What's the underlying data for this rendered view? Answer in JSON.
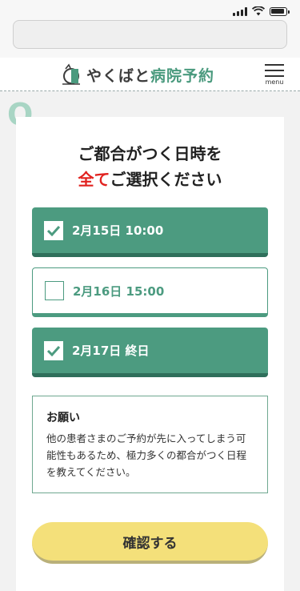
{
  "header": {
    "logo_part1": "やくばと",
    "logo_part2": "病院予約",
    "menu_label": "menu"
  },
  "question": {
    "badge": "Q",
    "title_line1": "ご都合がつく日時を",
    "title_emphasis": "全て",
    "title_line2_rest": "ご選択ください"
  },
  "options": [
    {
      "label": "2月15日 10:00",
      "checked": true
    },
    {
      "label": "2月16日 15:00",
      "checked": false
    },
    {
      "label": "2月17日 終日",
      "checked": true
    }
  ],
  "note": {
    "heading": "お願い",
    "body": "他の患者さまのご予約が先に入ってしまう可能性もあるため、極力多くの都合がつく日程を教えてください。"
  },
  "confirm_button": "確認する",
  "colors": {
    "accent": "#4c9b80",
    "accent_dark": "#2f6f5b",
    "emphasis_red": "#e1221f",
    "button_yellow": "#f4e07a",
    "q_badge": "#a8d5c4"
  }
}
